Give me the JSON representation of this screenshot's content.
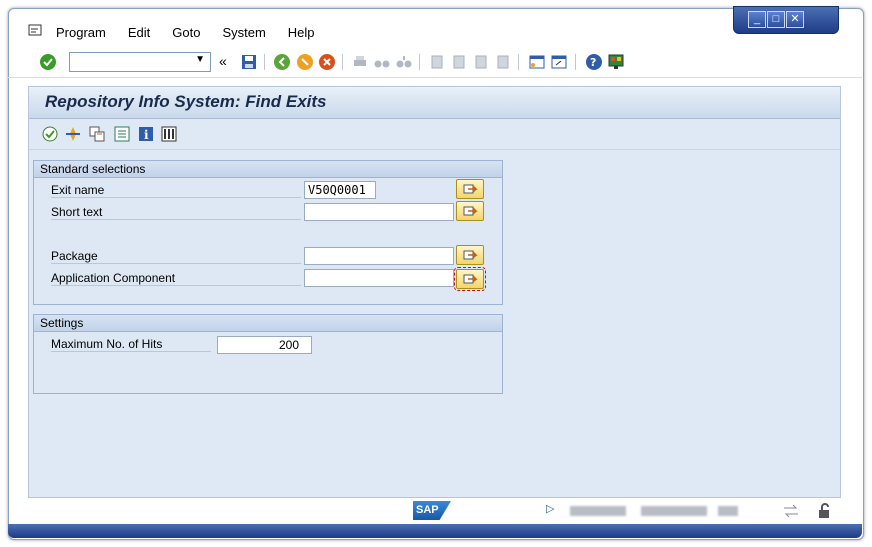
{
  "menu": {
    "items": [
      "Program",
      "Edit",
      "Goto",
      "System",
      "Help"
    ]
  },
  "toolbar": {
    "command_value": ""
  },
  "window_buttons": [
    "minimize",
    "restore",
    "close"
  ],
  "title": "Repository Info System: Find Exits",
  "groups": {
    "standard": {
      "header": "Standard selections",
      "fields": [
        {
          "label": "Exit name",
          "value": "V50Q0001"
        },
        {
          "label": "Short text",
          "value": ""
        },
        {
          "label": "Package",
          "value": ""
        },
        {
          "label": "Application Component",
          "value": ""
        }
      ]
    },
    "settings": {
      "header": "Settings",
      "max_hits_label": "Maximum No. of Hits",
      "max_hits_value": "200"
    }
  },
  "status": {
    "logo": "SAP"
  }
}
